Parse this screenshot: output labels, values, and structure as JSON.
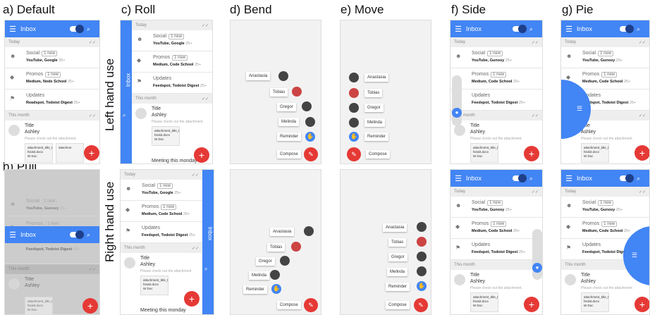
{
  "panel_labels": {
    "a": "a) Default",
    "b": "b) Pull",
    "c": "c) Roll",
    "d": "d) Bend",
    "e": "e) Move",
    "f": "f) Side",
    "g": "g) Pie"
  },
  "row_labels": {
    "left": "Left hand use",
    "right": "Right hand use"
  },
  "app": {
    "title": "Inbox",
    "menu_icon": "☰",
    "search_icon": "⌕",
    "today": "Today",
    "this_month": "This month",
    "check": "✓✓"
  },
  "bundles": {
    "social": {
      "name": "Social",
      "badge": "1 new",
      "senders": "YouTube, Google",
      "senders_alt": "YouTube, Gunosy",
      "more": "25+"
    },
    "promos": {
      "name": "Promos",
      "badge": "1 new",
      "senders": "Medium, Node School",
      "senders_alt": "Medium, Code School",
      "more": "25+"
    },
    "updates": {
      "name": "Updates",
      "senders": "Readspot, Todoist Digest",
      "senders_alt": "Feedspot, Todoist Digest",
      "more": "25+"
    }
  },
  "mail": {
    "title": "Title",
    "sender": "Ashley",
    "preview": "Please check out the attachment.",
    "attachment_name": "attachment_title_t",
    "attachment_file": "hisisit.docx",
    "attachment_type": "W Doc",
    "attachment_cut": "attachme",
    "meeting": "Meeting this monday"
  },
  "roll": {
    "sidebar_title": "Inbox"
  },
  "contacts": [
    "Anastasia",
    "Tobias",
    "Gregor",
    "Melinda",
    "Reminder",
    "Compose"
  ],
  "fab": {
    "plus": "+",
    "pencil": "✎"
  },
  "colors": {
    "primary": "#4285f4",
    "accent": "#e53935"
  }
}
